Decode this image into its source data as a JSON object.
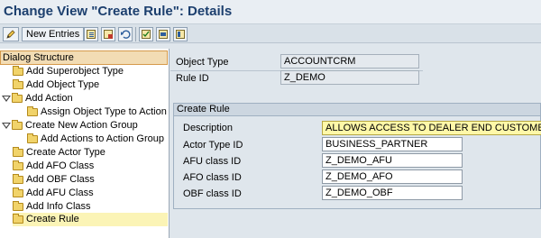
{
  "window": {
    "title": "Change View \"Create Rule\": Details"
  },
  "toolbar": {
    "new_entries_label": "New Entries",
    "icons": [
      "edit-icon",
      "copy-icon",
      "delete-icon",
      "undo-icon",
      "select-all-icon",
      "deselect-icon",
      "block-icon",
      "config-icon"
    ]
  },
  "tree": {
    "header": "Dialog Structure",
    "items": [
      {
        "label": "Add Superobject Type",
        "level": 1,
        "expander": "none"
      },
      {
        "label": "Add Object Type",
        "level": 1,
        "expander": "none"
      },
      {
        "label": "Add Action",
        "level": 0,
        "expander": "expanded"
      },
      {
        "label": "Assign Object Type to Action",
        "level": 2,
        "expander": "none"
      },
      {
        "label": "Create New Action Group",
        "level": 0,
        "expander": "expanded"
      },
      {
        "label": "Add Actions to Action Group",
        "level": 2,
        "expander": "none"
      },
      {
        "label": "Create Actor Type",
        "level": 1,
        "expander": "none"
      },
      {
        "label": "Add AFO Class",
        "level": 1,
        "expander": "none"
      },
      {
        "label": "Add OBF Class",
        "level": 1,
        "expander": "none"
      },
      {
        "label": "Add AFU Class",
        "level": 1,
        "expander": "none"
      },
      {
        "label": "Add Info Class",
        "level": 1,
        "expander": "none"
      },
      {
        "label": "Create Rule",
        "level": 1,
        "expander": "none",
        "selected": true
      }
    ]
  },
  "header_fields": {
    "object_type_label": "Object Type",
    "object_type_value": "ACCOUNTCRM",
    "rule_id_label": "Rule ID",
    "rule_id_value": "Z_DEMO"
  },
  "create_rule": {
    "title": "Create Rule",
    "description_label": "Description",
    "description_value": "ALLOWS ACCESS TO DEALER END CUSTOMER",
    "actor_type_label": "Actor Type ID",
    "actor_type_value": "BUSINESS_PARTNER",
    "afu_label": "AFU class ID",
    "afu_value": "Z_DEMO_AFU",
    "afo_label": "AFO class ID",
    "afo_value": "Z_DEMO_AFO",
    "obf_label": "OBF class ID",
    "obf_value": "Z_DEMO_OBF"
  },
  "colors": {
    "title": "#1c3f6e",
    "tree_header_bg": "#f2dcb4",
    "selected_row_bg": "#fbf4b6",
    "focus_field_bg": "#fff8a8"
  }
}
